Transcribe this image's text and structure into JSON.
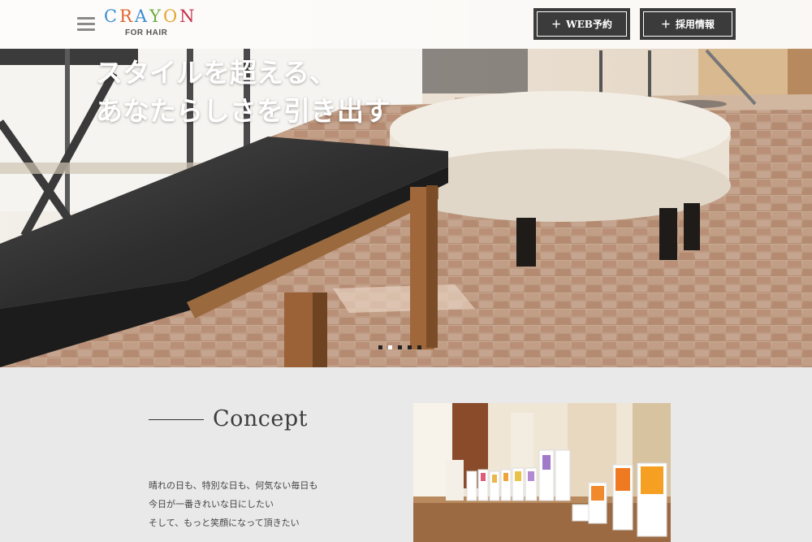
{
  "header": {
    "logo": {
      "letters": [
        {
          "char": "C",
          "color": "#3a8fcf"
        },
        {
          "char": "R",
          "color": "#e0642c"
        },
        {
          "char": "A",
          "color": "#3a8fcf"
        },
        {
          "char": "Y",
          "color": "#6cae3e"
        },
        {
          "char": "O",
          "color": "#e3a72f"
        },
        {
          "char": "N",
          "color": "#c8324a"
        }
      ],
      "subtitle": "FOR HAIR"
    },
    "buttons": {
      "reserve_label": "WEB予約",
      "recruit_label": "採用情報",
      "plus": "＋"
    }
  },
  "hero": {
    "catch_line1": "スタイルを超える、",
    "catch_line2": "あなたらしさを引き出す",
    "slide_count": 5,
    "active_slide": 1
  },
  "concept": {
    "title": "Concept",
    "lines": [
      "晴れの日も、特別な日も、何気ない毎日も",
      "今日が一番きれいな日にしたい",
      "そして、もっと笑顔になって頂きたい"
    ]
  },
  "colors": {
    "button_bg": "#3b3b3b",
    "section_bg": "#e9e9e9"
  }
}
